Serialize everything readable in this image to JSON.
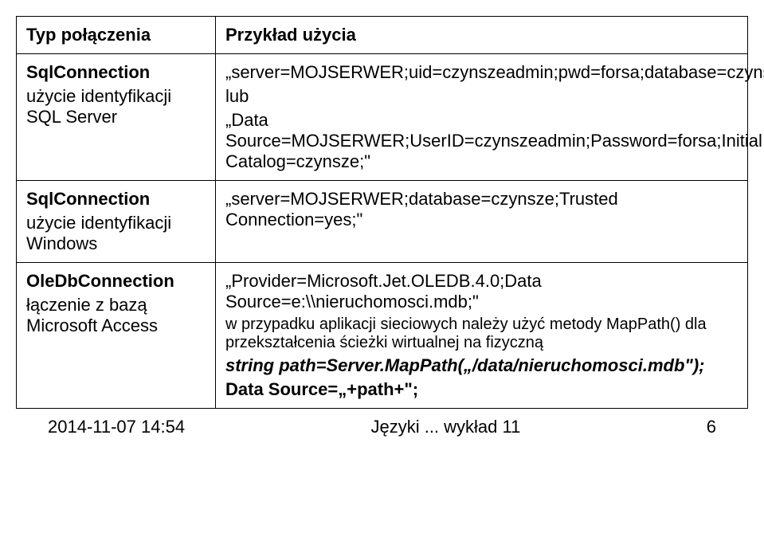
{
  "header": {
    "col1": "Typ połączenia",
    "col2": "Przykład użycia"
  },
  "rows": [
    {
      "left": {
        "name": "SqlConnection",
        "desc1": "użycie identyfikacji SQL Server"
      },
      "right": {
        "l1": "„server=MOJSERWER;uid=czynszeadmin;pwd=forsa;database=czynsze;\"",
        "l2": "lub",
        "l3": "„Data Source=MOJSERWER;UserID=czynszeadmin;Password=forsa;Initial Catalog=czynsze;\""
      }
    },
    {
      "left": {
        "name": "SqlConnection",
        "desc1": "użycie identyfikacji Windows"
      },
      "right": {
        "l1": "„server=MOJSERWER;database=czynsze;Trusted Connection=yes;\""
      }
    },
    {
      "left": {
        "name": "OleDbConnection",
        "desc1": "łączenie z bazą Microsoft Access"
      },
      "right": {
        "l1": "„Provider=Microsoft.Jet.OLEDB.4.0;Data Source=e:\\\\nieruchomosci.mdb;\"",
        "note": "w przypadku aplikacji sieciowych należy użyć metody MapPath() dla przekształcenia ścieżki wirtualnej na fizyczną",
        "l2": "string path=Server.MapPath(„/data/nieruchomosci.mdb\");",
        "l3": "Data Source=„+path+\";"
      }
    }
  ],
  "footer": {
    "date": "2014-11-07 14:54",
    "title": "Języki ... wykład 11",
    "page": "6"
  }
}
